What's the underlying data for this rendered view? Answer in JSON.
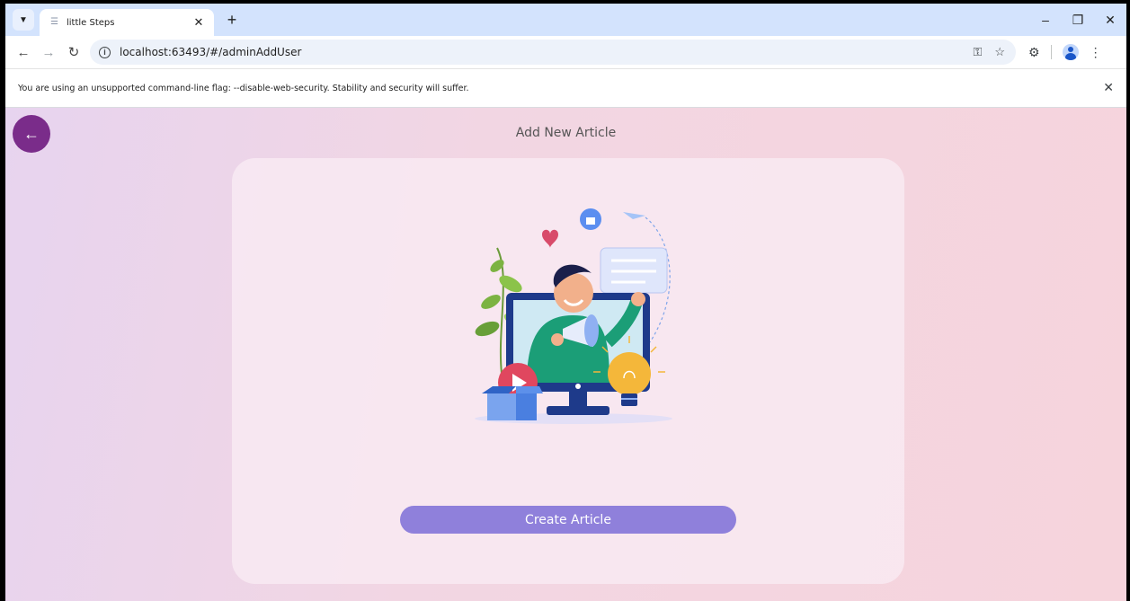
{
  "browser": {
    "tab_title": "little Steps",
    "url": "localhost:63493/#/adminAddUser",
    "infobar_text": "You are using an unsupported command-line flag: --disable-web-security. Stability and security will suffer."
  },
  "page": {
    "title": "Add New Article",
    "create_button_label": "Create Article"
  },
  "icons": {
    "back": "arrow-left-icon",
    "illustration": "megaphone-monitor-illustration"
  },
  "colors": {
    "back_button": "#7a2c8a",
    "create_button": "#8f80db"
  }
}
